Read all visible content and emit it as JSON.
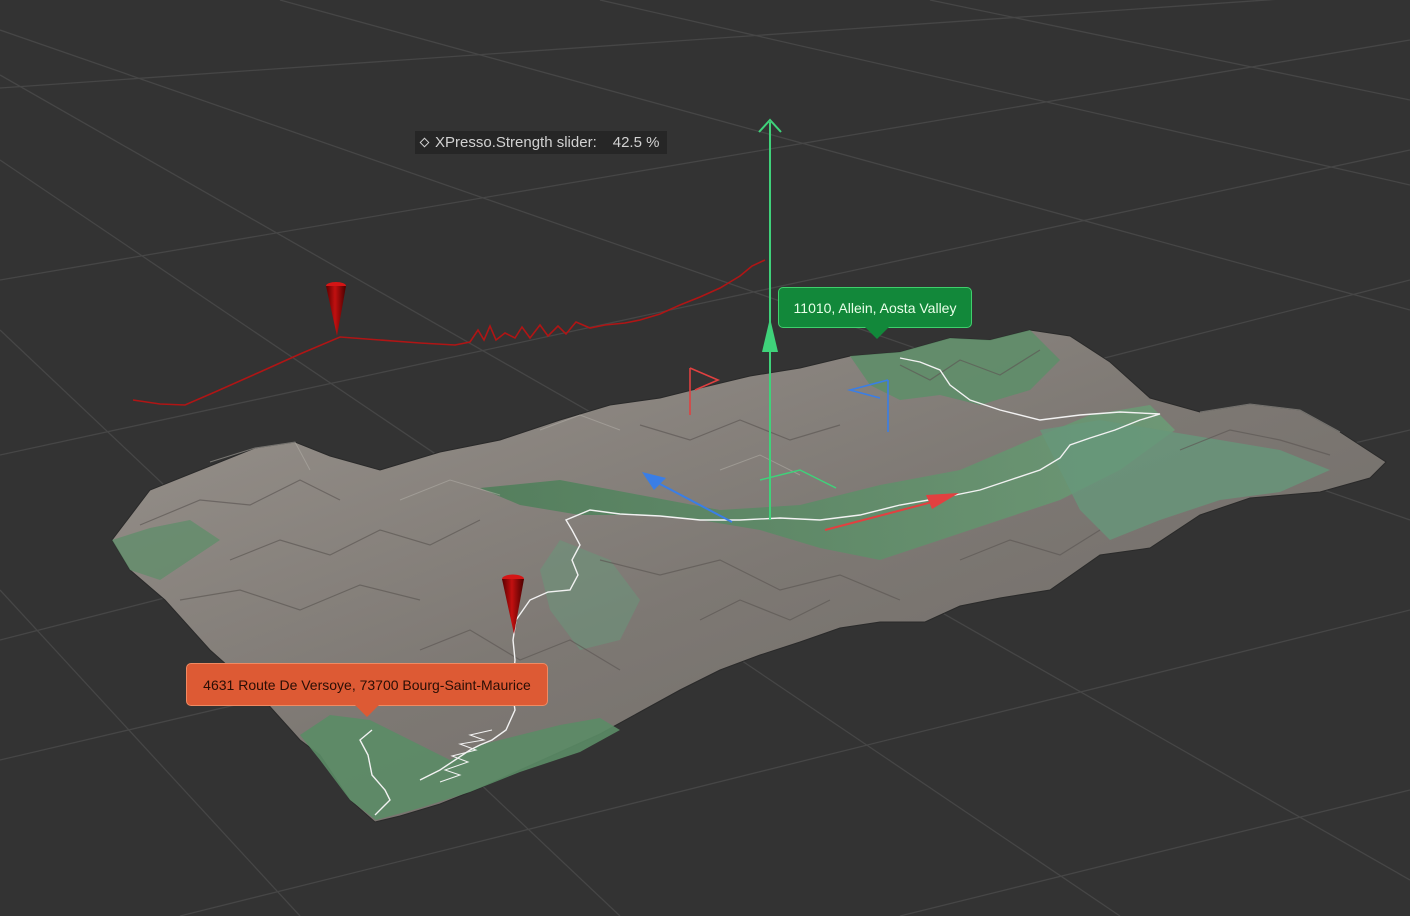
{
  "hud": {
    "label": "XPresso.Strength slider:",
    "value": "42.5 %"
  },
  "callouts": {
    "destination": "11010, Allein, Aosta Valley",
    "origin": "4631 Route De Versoye, 73700 Bourg-Saint-Maurice"
  },
  "colors": {
    "background": "#333333",
    "grid": "#464646",
    "terrain_rock": "#8a8580",
    "terrain_valley": "#5f8f6a",
    "route_line": "#f2f2f2",
    "elevation_profile": "#b01515",
    "axis_x": "#e24040",
    "axis_y": "#3fd27a",
    "axis_z": "#3a7ee6",
    "destination_callout": "#12883a",
    "origin_callout": "#dd5a34"
  },
  "icons": [
    "diamond-keyframe-icon",
    "pin-marker-icon",
    "flag-marker-icon"
  ]
}
